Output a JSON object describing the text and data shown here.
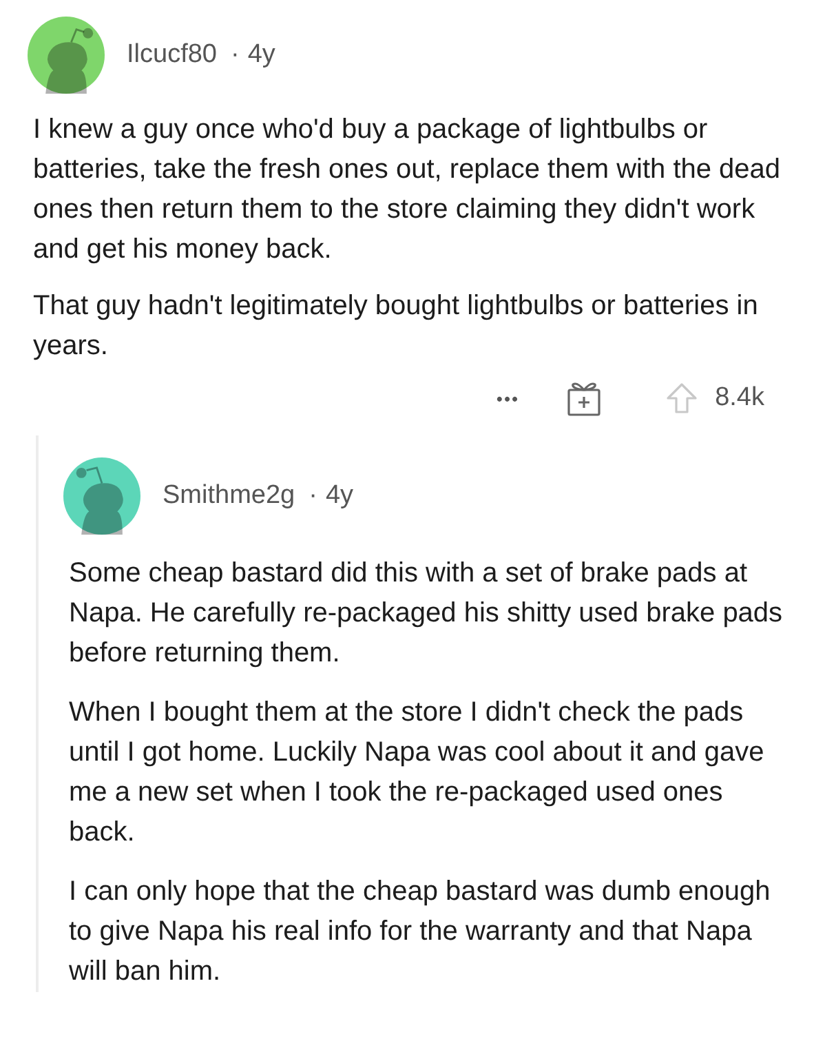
{
  "comments": [
    {
      "username": "Ilcucf80",
      "separator": "·",
      "age": "4y",
      "color": "#7fd66b",
      "paragraphs": [
        "I knew a guy once who'd buy a package of lightbulbs or batteries, take the fresh ones out, replace them with the dead ones then return them to the store claiming they didn't work and get his money back.",
        "That guy hadn't legitimately bought lightbulbs or batteries in years."
      ],
      "actions": {
        "more": "•••",
        "score": "8.4k"
      },
      "children": [
        {
          "username": "Smithme2g",
          "separator": "·",
          "age": "4y",
          "color": "#5cd6b8",
          "paragraphs": [
            "Some cheap bastard did this with a set of brake pads at Napa. He carefully re-packaged his shitty used brake pads before returning them.",
            "When I bought them at the store I didn't check the pads until I got home. Luckily Napa was cool about it and gave me a new set when I took the re-packaged used ones back.",
            "I can only hope that the cheap bastard was dumb enough to give Napa his real info for the warranty and that Napa will ban him."
          ]
        }
      ]
    }
  ]
}
